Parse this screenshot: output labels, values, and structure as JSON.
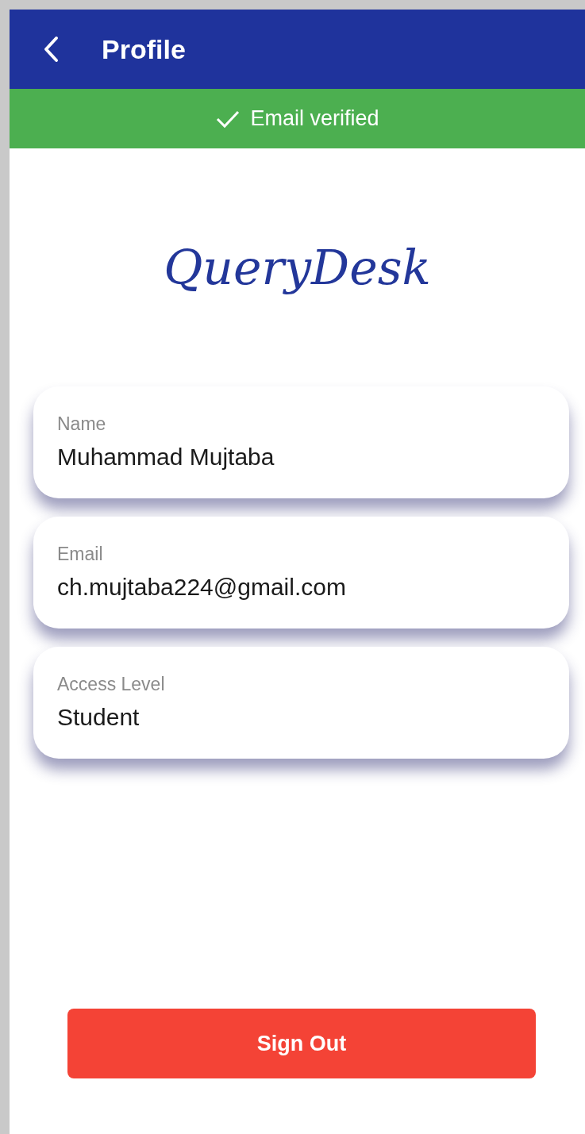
{
  "header": {
    "title": "Profile"
  },
  "banner": {
    "text": "Email verified",
    "verified": true
  },
  "logo": {
    "text": "QueryDesk"
  },
  "fields": [
    {
      "label": "Name",
      "value": "Muhammad Mujtaba"
    },
    {
      "label": "Email",
      "value": "ch.mujtaba224@gmail.com"
    },
    {
      "label": "Access Level",
      "value": "Student"
    }
  ],
  "buttons": [
    {
      "label": "Sign Out"
    }
  ]
}
